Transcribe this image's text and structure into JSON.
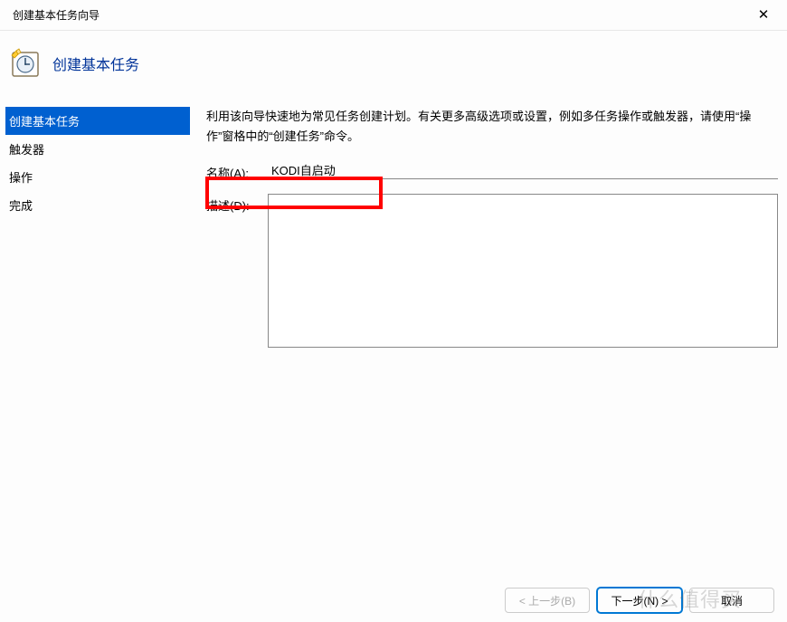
{
  "window": {
    "title": "创建基本任务向导"
  },
  "header": {
    "title": "创建基本任务"
  },
  "sidebar": {
    "items": [
      {
        "label": "创建基本任务",
        "active": true
      },
      {
        "label": "触发器",
        "active": false
      },
      {
        "label": "操作",
        "active": false
      },
      {
        "label": "完成",
        "active": false
      }
    ]
  },
  "main": {
    "instruction": "利用该向导快速地为常见任务创建计划。有关更多高级选项或设置，例如多任务操作或触发器，请使用“操作”窗格中的“创建任务”命令。",
    "name_label": "名称(A):",
    "name_value": "KODI自启动",
    "desc_label": "描述(D):",
    "desc_value": ""
  },
  "footer": {
    "back": "< 上一步(B)",
    "next": "下一步(N) >",
    "cancel": "取消"
  },
  "watermark": "什么值得买"
}
